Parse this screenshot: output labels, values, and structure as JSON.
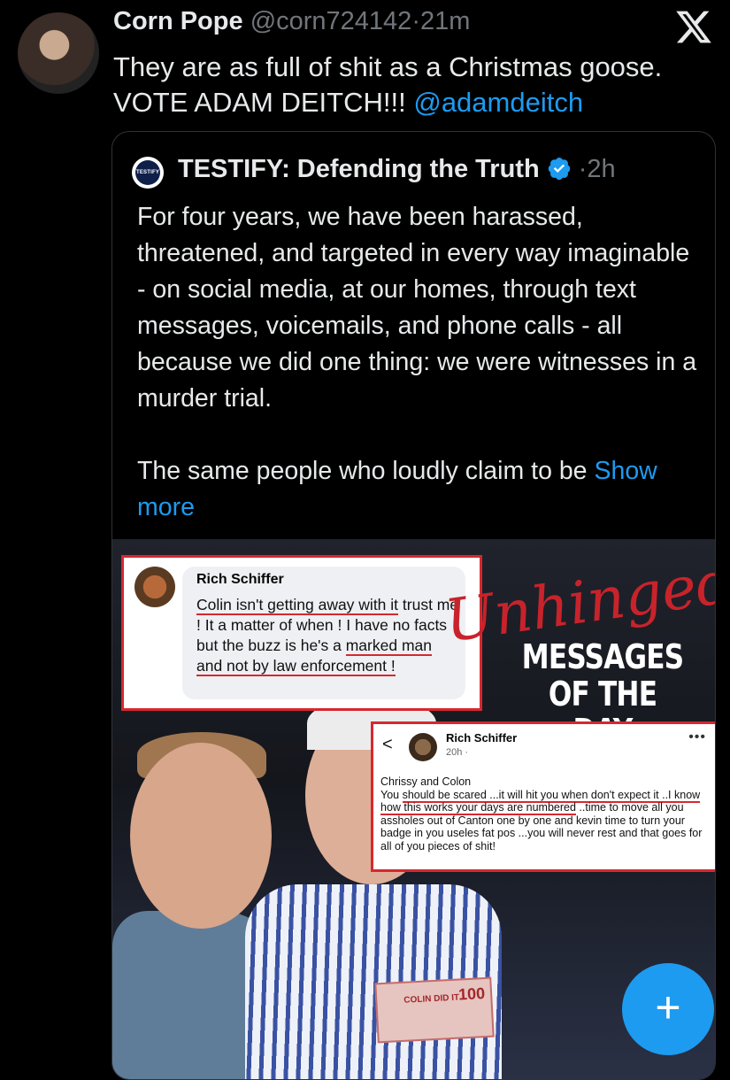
{
  "tweet": {
    "author_name": "Corn Pope",
    "author_handle": "@corn724142",
    "separator": "·",
    "time": "21m",
    "text": "They are as full of shit as a Christmas goose. VOTE ADAM DEITCH!!!",
    "mention": "@adamdeitch"
  },
  "quote": {
    "avatar_text": "TESTIFY",
    "author_name": "TESTIFY: Defending the Truth",
    "separator": "·",
    "time": "2h",
    "paragraph1": "For four years, we have been harassed, threatened, and targeted in every way imaginable - on social media, at our homes, through text messages, voicemails, and phone calls - all because we did one thing: we were witnesses in a murder trial.",
    "paragraph2": "The same people who loudly claim to be",
    "show_more": "Show more"
  },
  "image": {
    "comment1": {
      "name": "Rich Schiffer",
      "text_part1": "Colin isn't getting away with it",
      "text_part2": "trust me ! It a matter of when ! I have no facts but the buzz is he's a",
      "text_part3": "marked man and not by law enforcement !"
    },
    "headline_script": "Unhinged",
    "headline": "MESSAGES OF THE DAY",
    "comment2": {
      "back": "<",
      "name": "Rich Schiffer",
      "time": "20h ·",
      "menu": "•••",
      "line1": "Chrissy and Colon",
      "text_part1": "You",
      "text_part2": "should be scared ...it will hit you when don't expect it ..I know how this works your days are numbered",
      "text_part3": "..time to move all you assholes out of Canton one by one and kevin time to turn your badge in you useles fat pos ...you will never rest and that goes for all of you pieces of shit!"
    },
    "bill_text": "COLIN DID IT",
    "bill_number": "100"
  },
  "fab_label": "+",
  "colors": {
    "accent": "#1d9bf0",
    "background": "#000000",
    "muted": "#71767b",
    "highlight_red": "#d6282f"
  }
}
